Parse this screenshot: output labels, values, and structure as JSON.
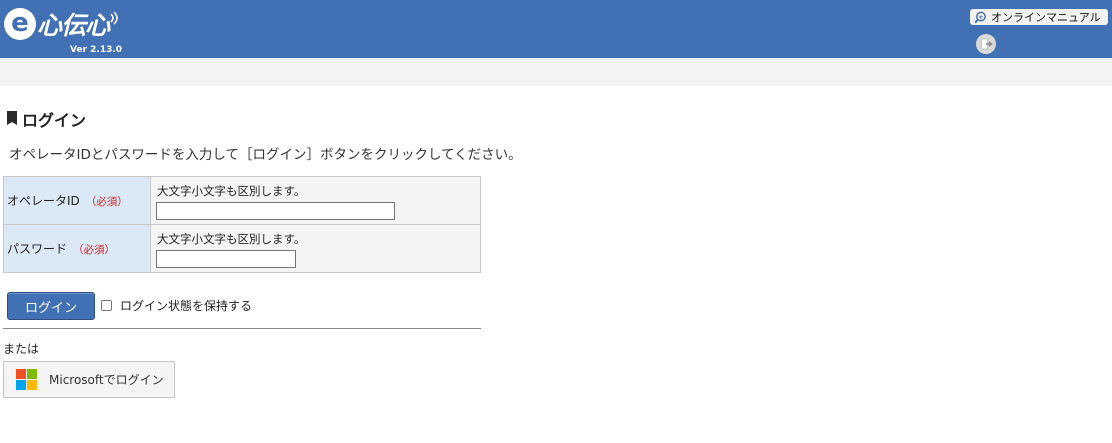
{
  "header": {
    "logo_text": "心伝心",
    "logo_letter": "e",
    "version": "Ver 2.13.0",
    "manual_label": "オンラインマニュアル",
    "accent_color": "#4270b5"
  },
  "login": {
    "title": "ログイン",
    "instruction": "オペレータIDとパスワードを入力して［ログイン］ボタンをクリックしてください。",
    "fields": [
      {
        "label": "オペレータID",
        "required": "（必須）",
        "hint": "大文字小文字も区別します。",
        "value": ""
      },
      {
        "label": "パスワード",
        "required": "（必須）",
        "hint": "大文字小文字も区別します。",
        "value": ""
      }
    ],
    "submit_label": "ログイン",
    "keep_login_label": "ログイン状態を保持する",
    "keep_login_checked": false,
    "or_label": "または",
    "microsoft_label": "Microsoftでログイン"
  },
  "icons": {
    "manual": "search-manual-icon",
    "logout": "logout-icon",
    "title_mark": "bookmark-icon",
    "microsoft": "microsoft-logo"
  }
}
